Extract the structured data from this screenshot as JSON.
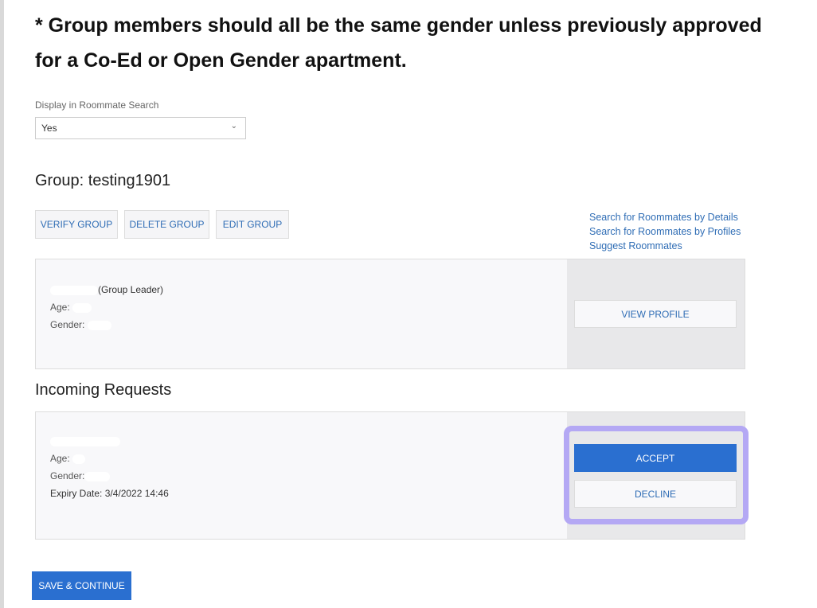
{
  "notice": "* Group members should all be the same gender unless previously approved for a Co-Ed or Open Gender apartment.",
  "display_search": {
    "label": "Display in Roommate Search",
    "value": "Yes"
  },
  "group": {
    "title": "Group: testing1901",
    "buttons": [
      "VERIFY GROUP",
      "DELETE GROUP",
      "EDIT GROUP"
    ],
    "links": [
      "Search for Roommates by Details",
      "Search for Roommates by Profiles",
      "Suggest Roommates"
    ]
  },
  "member": {
    "role": "(Group Leader)",
    "age_label": "Age:",
    "gender_label": "Gender:",
    "view_profile": "VIEW PROFILE"
  },
  "incoming": {
    "title": "Incoming Requests",
    "age_label": "Age:",
    "gender_label": "Gender:",
    "expiry": "Expiry Date: 3/4/2022 14:46",
    "accept": "ACCEPT",
    "decline": "DECLINE"
  },
  "save": "SAVE & CONTINUE",
  "colors": {
    "primary": "#2a6fd0",
    "link": "#2f6db5",
    "highlight": "#b4a8f4"
  }
}
